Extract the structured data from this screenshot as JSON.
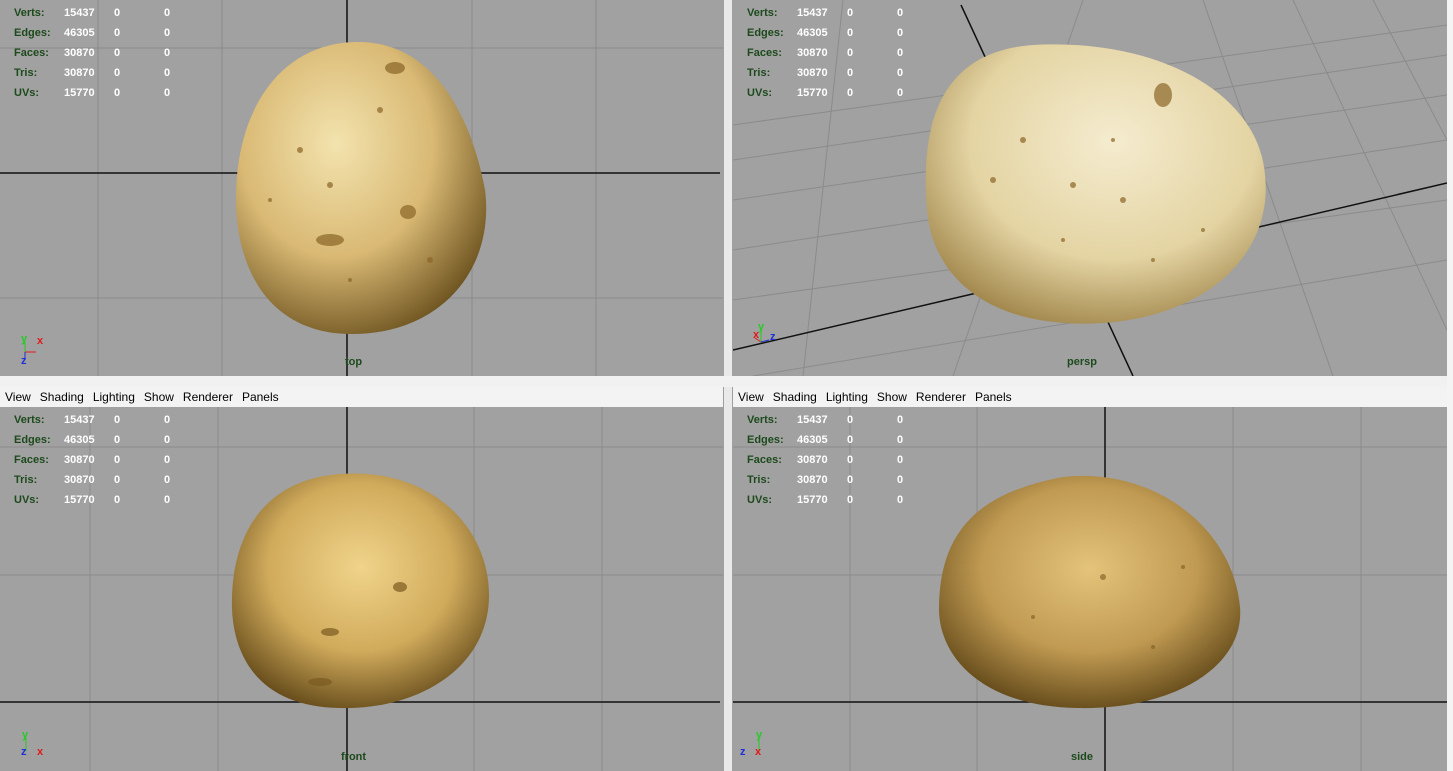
{
  "menus": [
    "View",
    "Shading",
    "Lighting",
    "Show",
    "Renderer",
    "Panels"
  ],
  "hud": [
    {
      "label": "Verts:",
      "value": "15437",
      "a": "0",
      "b": "0"
    },
    {
      "label": "Edges:",
      "value": "46305",
      "a": "0",
      "b": "0"
    },
    {
      "label": "Faces:",
      "value": "30870",
      "a": "0",
      "b": "0"
    },
    {
      "label": "Tris:",
      "value": "30870",
      "a": "0",
      "b": "0"
    },
    {
      "label": "UVs:",
      "value": "15770",
      "a": "0",
      "b": "0"
    }
  ],
  "viewports": {
    "top": {
      "camera": "top",
      "axis": [
        "y",
        "x",
        "z"
      ]
    },
    "persp": {
      "camera": "persp",
      "axis": [
        "x",
        "y",
        "z"
      ]
    },
    "front": {
      "camera": "front",
      "axis": [
        "y",
        "z",
        "x"
      ]
    },
    "side": {
      "camera": "side",
      "axis": [
        "y",
        "z",
        "x"
      ]
    }
  },
  "colors": {
    "viewport_bg": "#a1a1a1",
    "grid": "#8b8b8b",
    "axis_line": "#111111",
    "hud_label": "#1d4a1d",
    "x_axis": "#e11a1a",
    "y_axis": "#23cc23",
    "z_axis": "#1f2fd8",
    "potato_light": "#e8d6a0",
    "potato_dark": "#8a6a2a"
  }
}
